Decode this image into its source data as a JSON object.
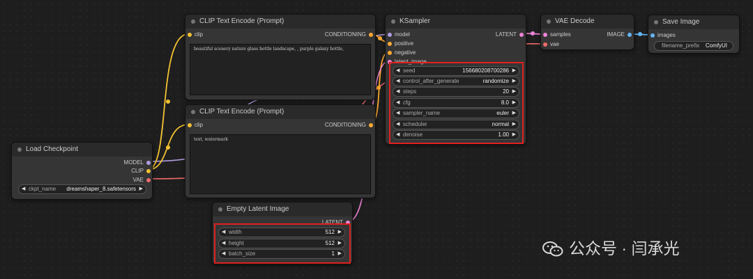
{
  "colors": {
    "clip": "#f3c233",
    "model": "#b09ce0",
    "vae": "#f26b6b",
    "latent": "#ef84d6",
    "conditioning": "#ffa931",
    "image": "#64b5f6",
    "highlight": "#e02020"
  },
  "nodes": {
    "load_checkpoint": {
      "title": "Load Checkpoint",
      "outputs": {
        "model": "MODEL",
        "clip": "CLIP",
        "vae": "VAE"
      },
      "ckpt_name": {
        "label": "ckpt_name",
        "value": "dreamshaper_8.safetensors"
      }
    },
    "clip_encode_positive": {
      "title": "CLIP Text Encode (Prompt)",
      "input": "clip",
      "output": "CONDITIONING",
      "text": "beautiful scenery nature glass bottle landscape, , purple galaxy bottle,"
    },
    "clip_encode_negative": {
      "title": "CLIP Text Encode (Prompt)",
      "input": "clip",
      "output": "CONDITIONING",
      "text": "text, watermark"
    },
    "empty_latent": {
      "title": "Empty Latent Image",
      "output": "LATENT",
      "widgets": [
        {
          "label": "width",
          "value": "512"
        },
        {
          "label": "height",
          "value": "512"
        },
        {
          "label": "batch_size",
          "value": "1"
        }
      ]
    },
    "ksampler": {
      "title": "KSampler",
      "inputs": [
        "model",
        "positive",
        "negative",
        "latent_image"
      ],
      "output": "LATENT",
      "widgets": [
        {
          "label": "seed",
          "value": "156680208700286"
        },
        {
          "label": "control_after_generate",
          "value": "randomize"
        },
        {
          "label": "steps",
          "value": "20"
        },
        {
          "label": "cfg",
          "value": "8.0"
        },
        {
          "label": "sampler_name",
          "value": "euler"
        },
        {
          "label": "scheduler",
          "value": "normal"
        },
        {
          "label": "denoise",
          "value": "1.00"
        }
      ]
    },
    "vae_decode": {
      "title": "VAE Decode",
      "inputs": [
        "samples",
        "vae"
      ],
      "output": "IMAGE"
    },
    "save_image": {
      "title": "Save Image",
      "input": "images",
      "filename_prefix": {
        "label": "filename_prefix",
        "value": "ComfyUI"
      }
    }
  },
  "watermark": {
    "text": "公众号 · 闫承光",
    "icon": "wechat-icon"
  }
}
